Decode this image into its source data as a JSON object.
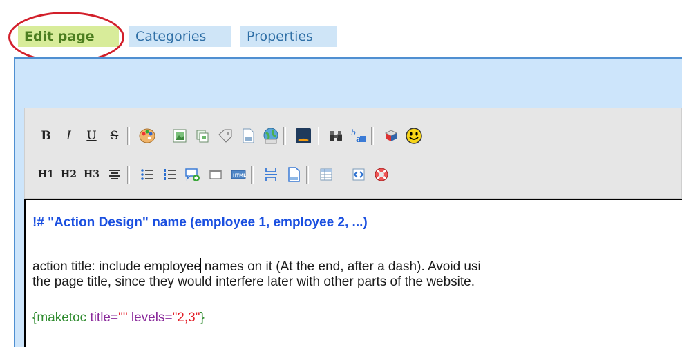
{
  "tabs": [
    {
      "label": "Edit page",
      "active": true
    },
    {
      "label": "Categories",
      "active": false
    },
    {
      "label": "Properties",
      "active": false
    }
  ],
  "toolbar": {
    "row1": [
      "bold",
      "italic",
      "underline",
      "strikethrough",
      "color-palette",
      "image",
      "copy",
      "tag",
      "file-gallery",
      "web-image",
      "rss",
      "find",
      "spellcheck",
      "3d-object",
      "smiley"
    ],
    "row2": [
      "heading-1",
      "heading-2",
      "heading-3",
      "align-center",
      "bullet-list",
      "numbered-list",
      "add-comment",
      "window",
      "html",
      "page-break",
      "page",
      "table",
      "code",
      "help"
    ],
    "text_labels": {
      "bold": "B",
      "italic": "I",
      "underline": "U",
      "strike": "S",
      "h1": "H1",
      "h2": "H2",
      "h3": "H3"
    }
  },
  "editor": {
    "heading": "!# \"Action Design\" name (employee 1, employee 2, ...)",
    "para_a": "action title: include employee",
    "para_b": " names on it (At the end, after a dash). Avoid usi",
    "para2": "the page title, since they would interfere later with other parts of the website.",
    "code": {
      "open": "{maketoc",
      "attr1": " title=",
      "val1": "\"\"",
      "attr2": " levels=",
      "val2": "\"2,3\"",
      "close": "}"
    }
  }
}
